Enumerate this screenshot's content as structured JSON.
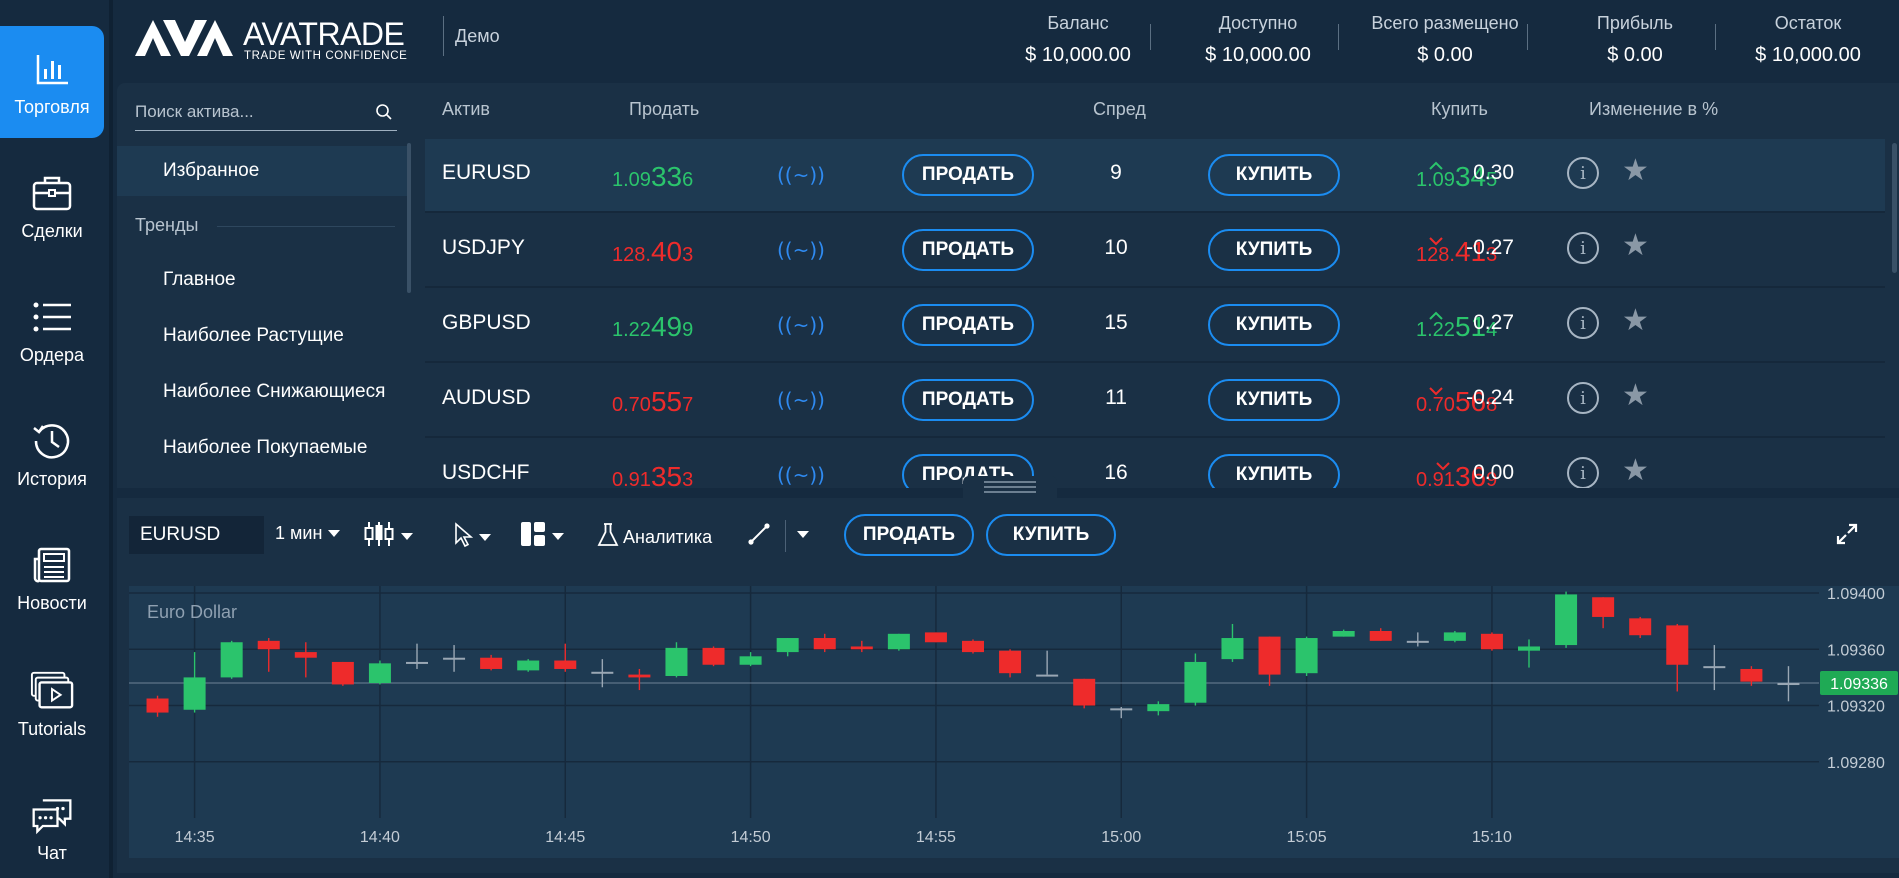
{
  "nav": [
    {
      "label": "Торговля",
      "icon": "bar-chart-icon",
      "active": true
    },
    {
      "label": "Сделки",
      "icon": "briefcase-icon",
      "active": false
    },
    {
      "label": "Ордера",
      "icon": "list-icon",
      "active": false
    },
    {
      "label": "История",
      "icon": "history-icon",
      "active": false
    },
    {
      "label": "Новости",
      "icon": "newspaper-icon",
      "active": false
    },
    {
      "label": "Tutorials",
      "icon": "video-icon",
      "active": false
    },
    {
      "label": "Чат",
      "icon": "chat-icon",
      "active": false
    }
  ],
  "header": {
    "brand": "AVATRADE",
    "tagline": "TRADE WITH CONFIDENCE",
    "mode": "Демо",
    "account": [
      {
        "label": "Баланс",
        "value": "$ 10,000.00"
      },
      {
        "label": "Доступно",
        "value": "$ 10,000.00"
      },
      {
        "label": "Всего размещено",
        "value": "$ 0.00"
      },
      {
        "label": "Прибыль",
        "value": "$ 0.00"
      },
      {
        "label": "Остаток",
        "value": "$ 10,000.00"
      }
    ]
  },
  "assets": {
    "search_placeholder": "Поиск актива...",
    "favorites": "Избранное",
    "trends_heading": "Тренды",
    "categories": [
      "Главное",
      "Наиболее Растущие",
      "Наиболее Снижающиеся",
      "Наиболее Покупаемые"
    ]
  },
  "table": {
    "headers": {
      "asset": "Актив",
      "sell": "Продать",
      "spread": "Спред",
      "buy": "Купить",
      "change": "Изменение в %"
    },
    "sell_label": "ПРОДАТЬ",
    "buy_label": "КУПИТЬ",
    "wave_glyph": "((~))",
    "rows": [
      {
        "symbol": "EURUSD",
        "sell": {
          "a": "1.09",
          "b": "33",
          "c": "6"
        },
        "buy": {
          "a": "1.09",
          "b": "34",
          "c": "5"
        },
        "spread": "9",
        "change": "0.30",
        "dir": "up",
        "color": "green"
      },
      {
        "symbol": "USDJPY",
        "sell": {
          "a": "128.",
          "b": "40",
          "c": "3"
        },
        "buy": {
          "a": "128.",
          "b": "41",
          "c": "3"
        },
        "spread": "10",
        "change": "-0.27",
        "dir": "down",
        "color": "red"
      },
      {
        "symbol": "GBPUSD",
        "sell": {
          "a": "1.22",
          "b": "49",
          "c": "9"
        },
        "buy": {
          "a": "1.22",
          "b": "51",
          "c": "4"
        },
        "spread": "15",
        "change": "0.27",
        "dir": "up",
        "color": "green"
      },
      {
        "symbol": "AUDUSD",
        "sell": {
          "a": "0.70",
          "b": "55",
          "c": "7"
        },
        "buy": {
          "a": "0.70",
          "b": "56",
          "c": "8"
        },
        "spread": "11",
        "change": "-0.24",
        "dir": "down",
        "color": "red"
      },
      {
        "symbol": "USDCHF",
        "sell": {
          "a": "0.91",
          "b": "35",
          "c": "3"
        },
        "buy": {
          "a": "0.91",
          "b": "36",
          "c": "9"
        },
        "spread": "16",
        "change": "0.00",
        "dir": "down",
        "color": "red"
      }
    ]
  },
  "chart_toolbar": {
    "symbol": "EURUSD",
    "timeframe": "1 мин",
    "analytics": "Аналитика",
    "sell": "ПРОДАТЬ",
    "buy": "КУПИТЬ"
  },
  "colors": {
    "accent": "#1b8cf1",
    "up": "#2bc46c",
    "down": "#ee2b2b"
  },
  "chart_data": {
    "type": "candlestick",
    "title": "Euro Dollar",
    "x_ticks": [
      "14:35",
      "14:40",
      "14:45",
      "14:50",
      "14:55",
      "15:00",
      "15:05",
      "15:10"
    ],
    "y_ticks": [
      1.094,
      1.0936,
      1.0932,
      1.0928
    ],
    "y_tick_labels": [
      "1.09400",
      "1.09360",
      "1.09320",
      "1.09280"
    ],
    "ylim": [
      1.09245,
      1.09405
    ],
    "current_price": 1.09336,
    "current_price_label": "1.09336",
    "candles": [
      {
        "o": 1.09325,
        "c": 1.09315,
        "h": 1.09327,
        "l": 1.09312
      },
      {
        "o": 1.09317,
        "c": 1.0934,
        "h": 1.09358,
        "l": 1.09315
      },
      {
        "o": 1.0934,
        "c": 1.09365,
        "h": 1.09366,
        "l": 1.09339
      },
      {
        "o": 1.09366,
        "c": 1.0936,
        "h": 1.09368,
        "l": 1.09344
      },
      {
        "o": 1.09358,
        "c": 1.09354,
        "h": 1.09365,
        "l": 1.0934
      },
      {
        "o": 1.09351,
        "c": 1.09335,
        "h": 1.09351,
        "l": 1.09334
      },
      {
        "o": 1.09336,
        "c": 1.0935,
        "h": 1.09352,
        "l": 1.09335
      },
      {
        "o": 1.09351,
        "c": 1.0935,
        "h": 1.09364,
        "l": 1.09346
      },
      {
        "o": 1.09354,
        "c": 1.09353,
        "h": 1.09363,
        "l": 1.09344
      },
      {
        "o": 1.09354,
        "c": 1.09346,
        "h": 1.09356,
        "l": 1.09345
      },
      {
        "o": 1.09345,
        "c": 1.09352,
        "h": 1.09353,
        "l": 1.09344
      },
      {
        "o": 1.09352,
        "c": 1.09346,
        "h": 1.09364,
        "l": 1.09344
      },
      {
        "o": 1.09344,
        "c": 1.09343,
        "h": 1.09353,
        "l": 1.09333
      },
      {
        "o": 1.09342,
        "c": 1.0934,
        "h": 1.09346,
        "l": 1.09331
      },
      {
        "o": 1.09341,
        "c": 1.09361,
        "h": 1.09365,
        "l": 1.0934
      },
      {
        "o": 1.09361,
        "c": 1.09349,
        "h": 1.09362,
        "l": 1.09348
      },
      {
        "o": 1.09349,
        "c": 1.09355,
        "h": 1.09358,
        "l": 1.09348
      },
      {
        "o": 1.09358,
        "c": 1.09368,
        "h": 1.09368,
        "l": 1.09355
      },
      {
        "o": 1.09368,
        "c": 1.0936,
        "h": 1.09371,
        "l": 1.09358
      },
      {
        "o": 1.09362,
        "c": 1.0936,
        "h": 1.09366,
        "l": 1.09358
      },
      {
        "o": 1.0936,
        "c": 1.09371,
        "h": 1.09371,
        "l": 1.09359
      },
      {
        "o": 1.09372,
        "c": 1.09365,
        "h": 1.09372,
        "l": 1.09365
      },
      {
        "o": 1.09366,
        "c": 1.09358,
        "h": 1.09367,
        "l": 1.09357
      },
      {
        "o": 1.09359,
        "c": 1.09343,
        "h": 1.0936,
        "l": 1.0934
      },
      {
        "o": 1.09342,
        "c": 1.09342,
        "h": 1.09359,
        "l": 1.09342
      },
      {
        "o": 1.09339,
        "c": 1.0932,
        "h": 1.09339,
        "l": 1.09318
      },
      {
        "o": 1.09317,
        "c": 1.09318,
        "h": 1.09319,
        "l": 1.09311
      },
      {
        "o": 1.09316,
        "c": 1.09321,
        "h": 1.09323,
        "l": 1.09313
      },
      {
        "o": 1.09322,
        "c": 1.09351,
        "h": 1.09357,
        "l": 1.0932
      },
      {
        "o": 1.09353,
        "c": 1.09368,
        "h": 1.09378,
        "l": 1.09351
      },
      {
        "o": 1.09369,
        "c": 1.09342,
        "h": 1.09369,
        "l": 1.09334
      },
      {
        "o": 1.09343,
        "c": 1.09368,
        "h": 1.09369,
        "l": 1.09341
      },
      {
        "o": 1.09369,
        "c": 1.09373,
        "h": 1.09374,
        "l": 1.09369
      },
      {
        "o": 1.09373,
        "c": 1.09366,
        "h": 1.09375,
        "l": 1.09366
      },
      {
        "o": 1.09366,
        "c": 1.09365,
        "h": 1.09372,
        "l": 1.09362
      },
      {
        "o": 1.09366,
        "c": 1.09372,
        "h": 1.09373,
        "l": 1.09365
      },
      {
        "o": 1.09371,
        "c": 1.0936,
        "h": 1.09372,
        "l": 1.09359
      },
      {
        "o": 1.09359,
        "c": 1.09362,
        "h": 1.09367,
        "l": 1.09347
      },
      {
        "o": 1.09363,
        "c": 1.09399,
        "h": 1.09401,
        "l": 1.09361
      },
      {
        "o": 1.09397,
        "c": 1.09383,
        "h": 1.09397,
        "l": 1.09375
      },
      {
        "o": 1.09382,
        "c": 1.0937,
        "h": 1.09383,
        "l": 1.09368
      },
      {
        "o": 1.09377,
        "c": 1.09349,
        "h": 1.09378,
        "l": 1.0933
      },
      {
        "o": 1.09348,
        "c": 1.09348,
        "h": 1.09363,
        "l": 1.09331
      },
      {
        "o": 1.09346,
        "c": 1.09337,
        "h": 1.09348,
        "l": 1.09334
      },
      {
        "o": 1.09336,
        "c": 1.09336,
        "h": 1.09348,
        "l": 1.09323
      }
    ]
  }
}
